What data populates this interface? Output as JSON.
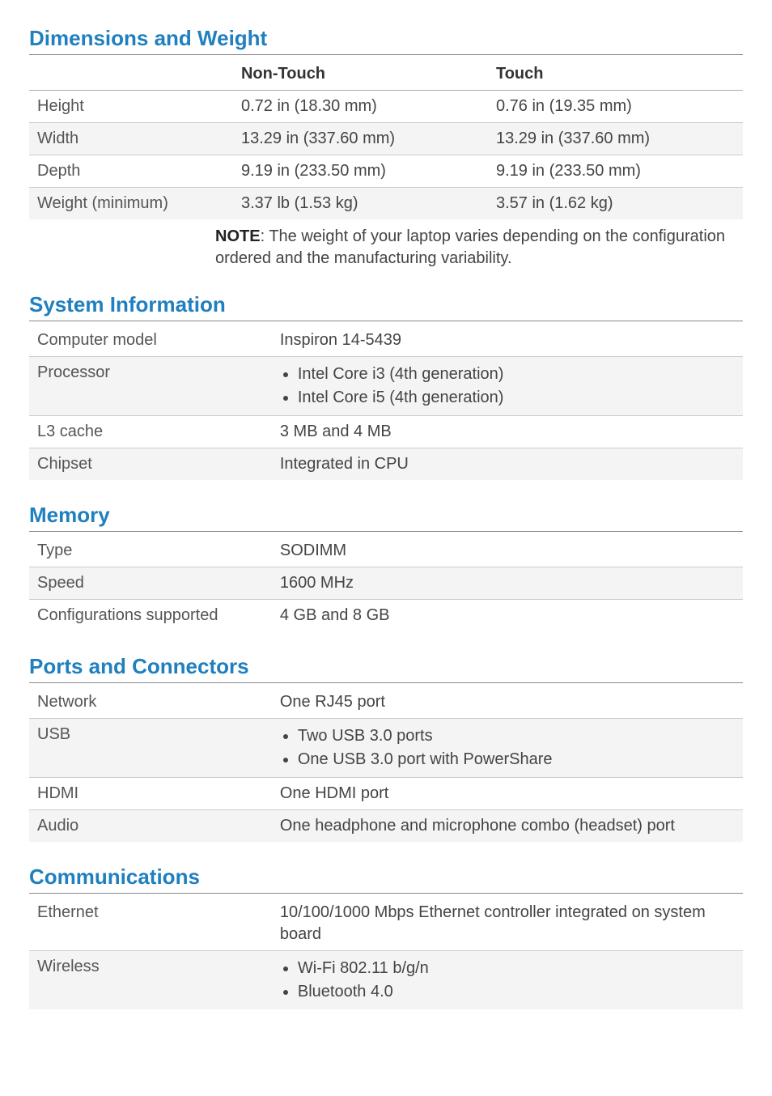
{
  "dimensions": {
    "title": "Dimensions and Weight",
    "headers": {
      "col1": "Non-Touch",
      "col2": "Touch"
    },
    "rows": [
      {
        "label": "Height",
        "nontouch": "0.72 in (18.30 mm)",
        "touch": "0.76 in (19.35 mm)"
      },
      {
        "label": "Width",
        "nontouch": "13.29 in (337.60 mm)",
        "touch": "13.29 in (337.60 mm)"
      },
      {
        "label": "Depth",
        "nontouch": "9.19 in (233.50 mm)",
        "touch": "9.19 in (233.50 mm)"
      },
      {
        "label": "Weight (minimum)",
        "nontouch": "3.37 lb (1.53 kg)",
        "touch": "3.57 in (1.62 kg)"
      }
    ],
    "note_label": "NOTE",
    "note_text": ": The weight of your laptop varies depending on the configuration ordered and the manufacturing variability."
  },
  "system": {
    "title": "System Information",
    "rows": {
      "model": {
        "label": "Computer model",
        "value": "Inspiron 14-5439"
      },
      "proc": {
        "label": "Processor",
        "items": [
          "Intel Core i3 (4th generation)",
          "Intel Core i5 (4th generation)"
        ]
      },
      "l3": {
        "label": "L3 cache",
        "value": "3 MB and 4 MB"
      },
      "chipset": {
        "label": "Chipset",
        "value": "Integrated in CPU"
      }
    }
  },
  "memory": {
    "title": "Memory",
    "rows": {
      "type": {
        "label": "Type",
        "value": "SODIMM"
      },
      "speed": {
        "label": "Speed",
        "value": "1600 MHz"
      },
      "conf": {
        "label": "Configurations supported",
        "value": "4 GB and 8 GB"
      }
    }
  },
  "ports": {
    "title": "Ports and Connectors",
    "rows": {
      "network": {
        "label": "Network",
        "value": "One RJ45 port"
      },
      "usb": {
        "label": "USB",
        "items": [
          "Two USB 3.0 ports",
          "One USB 3.0 port with PowerShare"
        ]
      },
      "hdmi": {
        "label": "HDMI",
        "value": "One HDMI port"
      },
      "audio": {
        "label": "Audio",
        "value": "One headphone and microphone combo (headset) port"
      }
    }
  },
  "comms": {
    "title": "Communications",
    "rows": {
      "ethernet": {
        "label": "Ethernet",
        "value": "10/100/1000 Mbps Ethernet controller integrated on system board"
      },
      "wireless": {
        "label": "Wireless",
        "items": [
          "Wi-Fi 802.11 b/g/n",
          "Bluetooth 4.0"
        ]
      }
    }
  }
}
